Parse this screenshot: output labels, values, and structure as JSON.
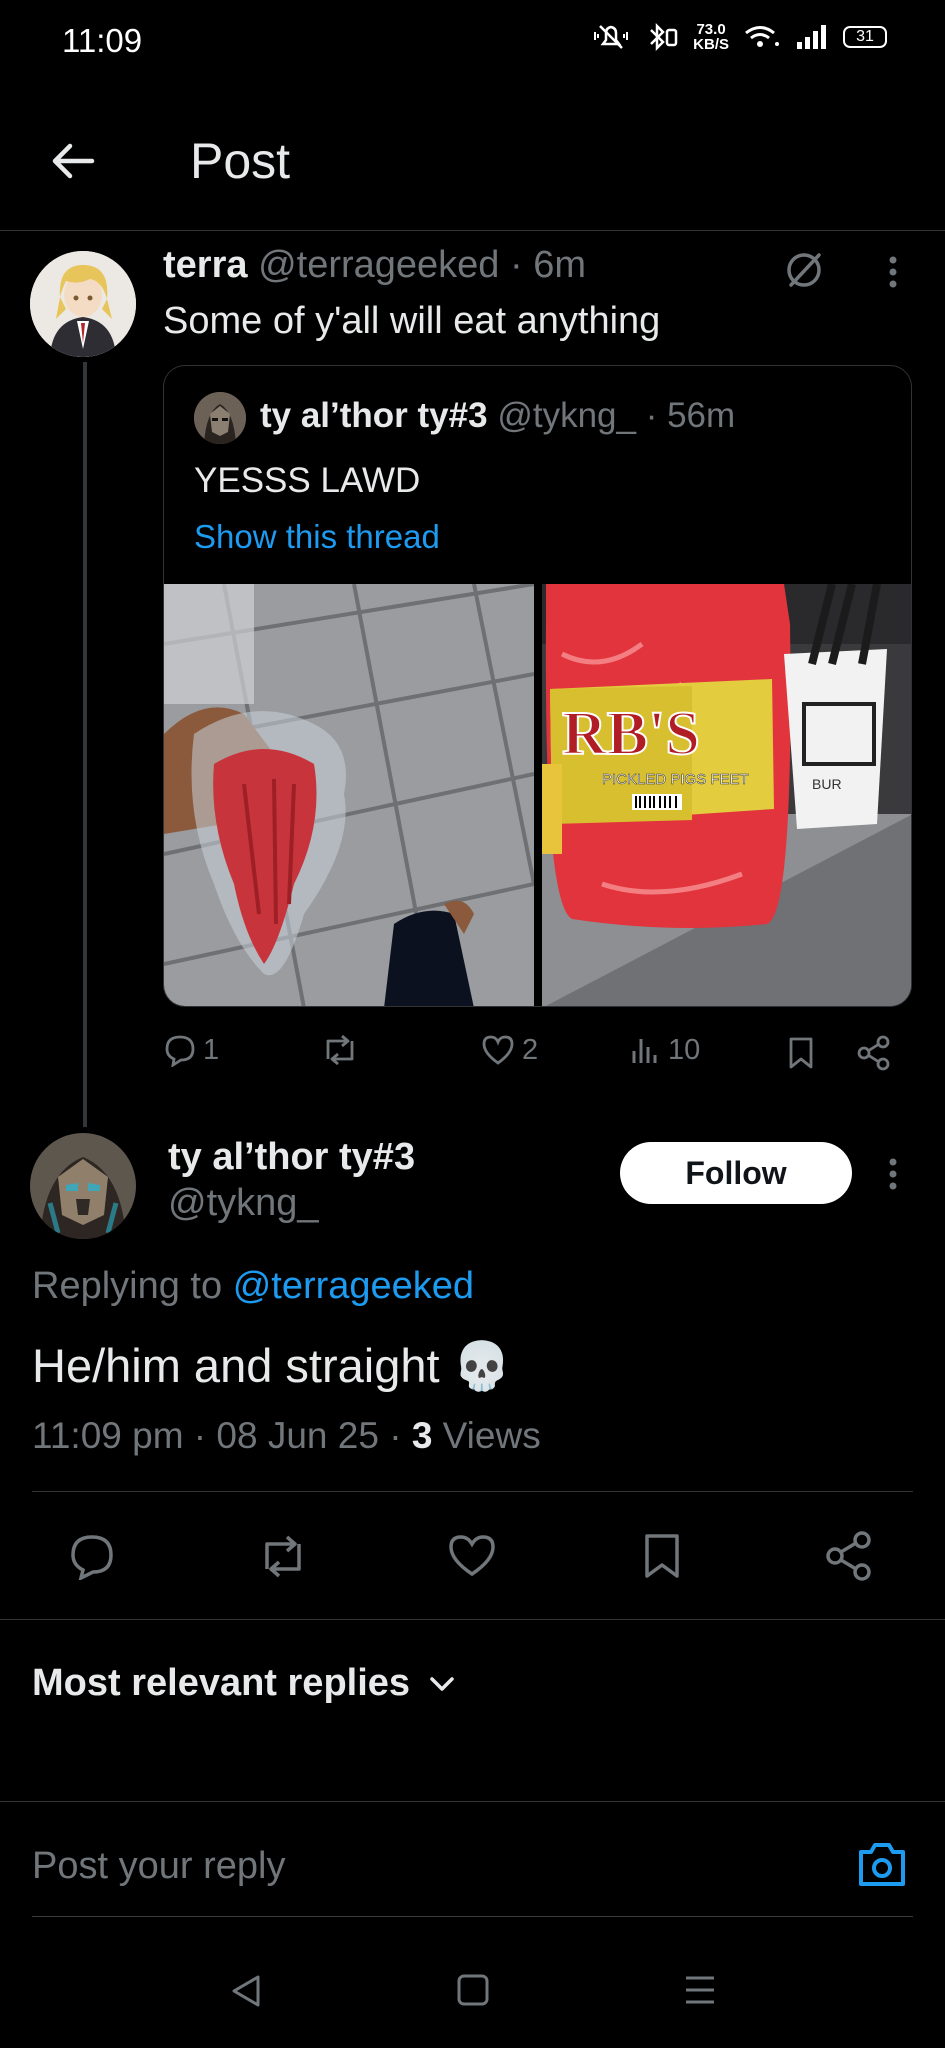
{
  "status_bar": {
    "time": "11:09",
    "speed_value": "73.0",
    "speed_unit": "KB/S",
    "battery": "31"
  },
  "header": {
    "title": "Post"
  },
  "parent_tweet": {
    "name": "terra",
    "handle": "@terrageeked",
    "time": "· 6m",
    "text": "Some of y'all will eat anything",
    "quote": {
      "name": "ty al’thor ty#3",
      "handle": "@tykng_",
      "time": "· 56m",
      "text": "YESSS LAWD",
      "thread_link": "Show this thread",
      "jar_label_main": "RB'S",
      "jar_label_sub": "PICKLED PIGS FEET",
      "cup_label": "BUR"
    },
    "actions": {
      "replies": "1",
      "reposts": "",
      "likes": "2",
      "views": "10"
    }
  },
  "main_tweet": {
    "name": "ty al’thor ty#3",
    "handle": "@tykng_",
    "follow_label": "Follow",
    "replying_prefix": "Replying to",
    "replying_handle": "@terrageeked",
    "text": "He/him and straight 💀",
    "timestamp": "11:09 pm · 08 Jun 25 ·",
    "views_count": "3",
    "views_label": "Views"
  },
  "replies_filter": {
    "label": "Most relevant replies"
  },
  "reply_box": {
    "placeholder": "Post your reply"
  },
  "colors": {
    "accent": "#1d9bf0",
    "background": "#000000",
    "muted": "#71767b",
    "divider": "#2f3336"
  }
}
